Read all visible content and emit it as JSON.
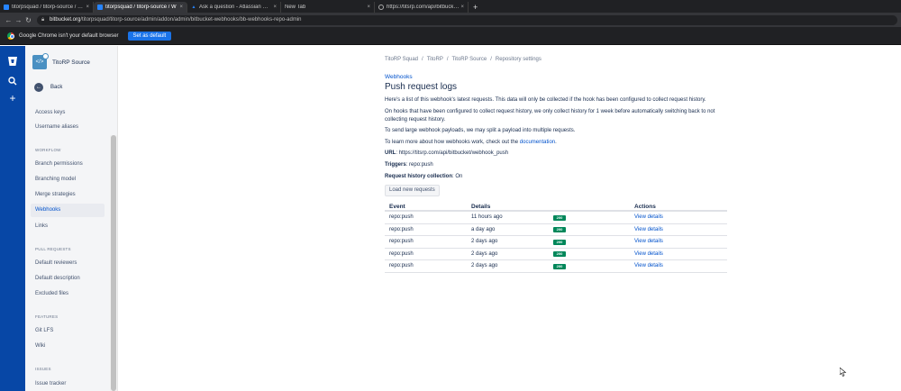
{
  "browser": {
    "tabs": [
      {
        "title": "titorpsquad / titorp-source / Web"
      },
      {
        "title": "titorpsquad / titorp-source / W"
      },
      {
        "title": "Ask a question - Atlassian Comm"
      },
      {
        "title": "New Tab"
      },
      {
        "title": "https://titsrp.com/api/bitbucket/"
      }
    ],
    "url_host": "bitbucket.org",
    "url_path": "/titorpsquad/titorp-source/admin/addon/admin/bitbucket-webhooks/bb-webhooks-repo-admin",
    "infobar_text": "Google Chrome isn't your default browser",
    "infobar_button": "Set as default"
  },
  "sidebar": {
    "repo_name": "TitoRP Source",
    "back_label": "Back",
    "top_items": [
      "Access keys",
      "Username aliases"
    ],
    "workflow_header": "WORKFLOW",
    "workflow_items": [
      "Branch permissions",
      "Branching model",
      "Merge strategies",
      "Webhooks",
      "Links"
    ],
    "pr_header": "PULL REQUESTS",
    "pr_items": [
      "Default reviewers",
      "Default description",
      "Excluded files"
    ],
    "features_header": "FEATURES",
    "features_items": [
      "Git LFS",
      "Wiki"
    ],
    "issues_header": "ISSUES",
    "issues_items": [
      "Issue tracker"
    ]
  },
  "main": {
    "breadcrumb": [
      "TitoRP Squad",
      "TitoRP",
      "TitoRP Source",
      "Repository settings"
    ],
    "back_link": "Webhooks",
    "title": "Push request logs",
    "para1": "Here's a list of this webhook's latest requests. This data will only be collected if the hook has been configured to collect request history.",
    "para2": "On hooks that have been configured to collect request history, we only collect history for 1 week before automatically switching back to not collecting request history.",
    "para3": "To send large webhook payloads, we may split a payload into multiple requests.",
    "para4_prefix": "To learn more about how webhooks work, check out the",
    "para4_link": "documentation",
    "para4_suffix": ".",
    "url_label": "URL",
    "url_value": "https://titsrp.com/api/bitbucket/webhook_push",
    "triggers_label": "Triggers",
    "triggers_value": "repo:push",
    "history_label": "Request history collection",
    "history_value": "On",
    "load_button": "Load new requests",
    "table": {
      "headers": [
        "Event",
        "Details",
        "",
        "Actions"
      ],
      "rows": [
        {
          "event": "repo:push",
          "time": "11 hours ago",
          "status": "200",
          "action": "View details"
        },
        {
          "event": "repo:push",
          "time": "a day ago",
          "status": "200",
          "action": "View details"
        },
        {
          "event": "repo:push",
          "time": "2 days ago",
          "status": "200",
          "action": "View details"
        },
        {
          "event": "repo:push",
          "time": "2 days ago",
          "status": "200",
          "action": "View details"
        },
        {
          "event": "repo:push",
          "time": "2 days ago",
          "status": "200",
          "action": "View details"
        }
      ]
    }
  },
  "colors": {
    "global_nav": "#0747a6",
    "link": "#0052cc",
    "success": "#00875a"
  },
  "icons": [
    "bitbucket-logo-icon",
    "search-icon",
    "plus-icon",
    "back-arrow-icon",
    "lock-icon",
    "chrome-logo-icon"
  ]
}
